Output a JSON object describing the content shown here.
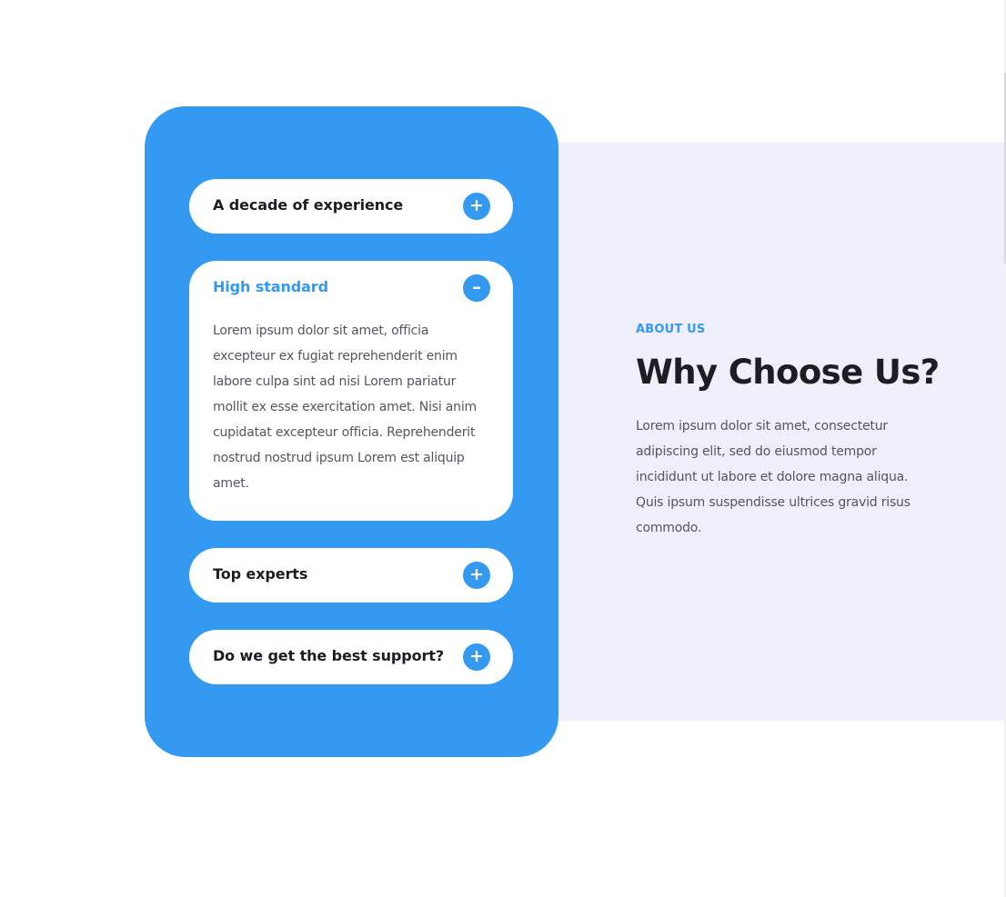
{
  "accordion": {
    "items": [
      {
        "title": "A decade of experience",
        "toggle": "+",
        "expanded": false,
        "body": ""
      },
      {
        "title": "High standard",
        "toggle": "–",
        "expanded": true,
        "body": "Lorem ipsum dolor sit amet, officia excepteur ex fugiat reprehenderit enim labore culpa sint ad nisi Lorem pariatur mollit ex esse exercitation amet. Nisi anim cupidatat excepteur officia. Reprehenderit nostrud nostrud ipsum Lorem est aliquip amet."
      },
      {
        "title": "Top experts",
        "toggle": "+",
        "expanded": false,
        "body": ""
      },
      {
        "title": "Do we get the best support?",
        "toggle": "+",
        "expanded": false,
        "body": ""
      }
    ]
  },
  "about": {
    "eyebrow": "ABOUT US",
    "heading": "Why Choose Us?",
    "text": "Lorem ipsum dolor sit amet, consectetur adipiscing elit, sed do eiusmod tempor incididunt ut labore et dolore magna aliqua. Quis ipsum suspendisse ultrices gravid risus commodo."
  },
  "colors": {
    "accent": "#3499f0",
    "panel_background": "#efeffc",
    "heading": "#1d1d24",
    "body_text": "#555562"
  }
}
